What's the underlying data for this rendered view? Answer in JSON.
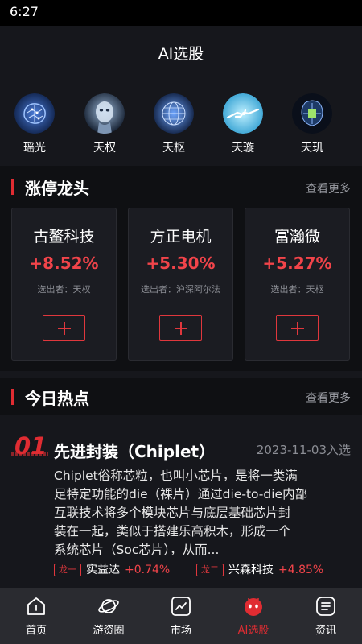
{
  "status": {
    "time": "6:27"
  },
  "page": {
    "title": "AI选股"
  },
  "models": [
    {
      "name": "瑶光",
      "icon": "brain-circuit-icon"
    },
    {
      "name": "天权",
      "icon": "robot-head-icon"
    },
    {
      "name": "天枢",
      "icon": "globe-network-icon"
    },
    {
      "name": "天璇",
      "icon": "robot-hand-icon"
    },
    {
      "name": "天玑",
      "icon": "ai-head-circuit-icon"
    }
  ],
  "limit_up": {
    "title": "涨停龙头",
    "more": "查看更多",
    "cards": [
      {
        "name": "古鳌科技",
        "change": "+8.52%",
        "picker": "选出者：天权"
      },
      {
        "name": "方正电机",
        "change": "+5.30%",
        "picker": "选出者：沪深阿尔法"
      },
      {
        "name": "富瀚微",
        "change": "+5.27%",
        "picker": "选出者：天枢"
      }
    ]
  },
  "hot": {
    "title": "今日热点",
    "more": "查看更多",
    "item": {
      "rank": "01",
      "title": "先进封装（Chiplet）",
      "date": "2023-11-03入选",
      "lines": [
        "Chiplet俗称芯粒，也叫小芯片，是将一类满",
        "足特定功能的die（裸片）通过die-to-die内部",
        "互联技术将多个模块芯片与底层基础芯片封",
        "装在一起，类似于搭建乐高积木，形成一个",
        "系统芯片（Soc芯片），从而..."
      ],
      "tags": [
        {
          "badge": "龙一",
          "name": "实益达",
          "change": "+0.74%"
        },
        {
          "badge": "龙二",
          "name": "兴森科技",
          "change": "+4.85%"
        }
      ]
    }
  },
  "tabbar": [
    {
      "label": "首页",
      "icon": "home-icon"
    },
    {
      "label": "游资圈",
      "icon": "planet-icon"
    },
    {
      "label": "市场",
      "icon": "chart-icon"
    },
    {
      "label": "AI选股",
      "icon": "robot-icon",
      "active": true
    },
    {
      "label": "资讯",
      "icon": "news-icon"
    }
  ],
  "colors": {
    "accent": "#e02c32",
    "background": "#16171c",
    "up": "#f2444a"
  }
}
